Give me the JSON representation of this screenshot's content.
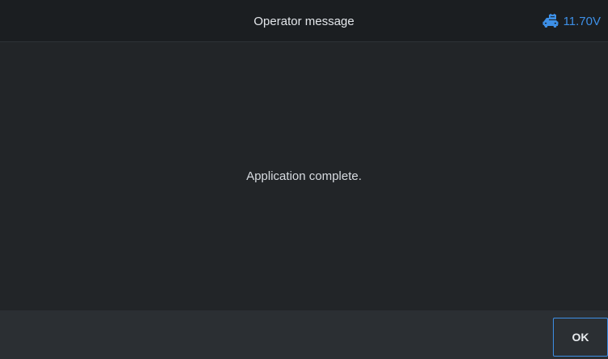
{
  "header": {
    "title": "Operator message",
    "voltage": "11.70V",
    "voltage_icon": "vehicle-battery-icon",
    "accent_color": "#3d8fe6"
  },
  "content": {
    "message": "Application complete."
  },
  "footer": {
    "ok_label": "OK"
  }
}
